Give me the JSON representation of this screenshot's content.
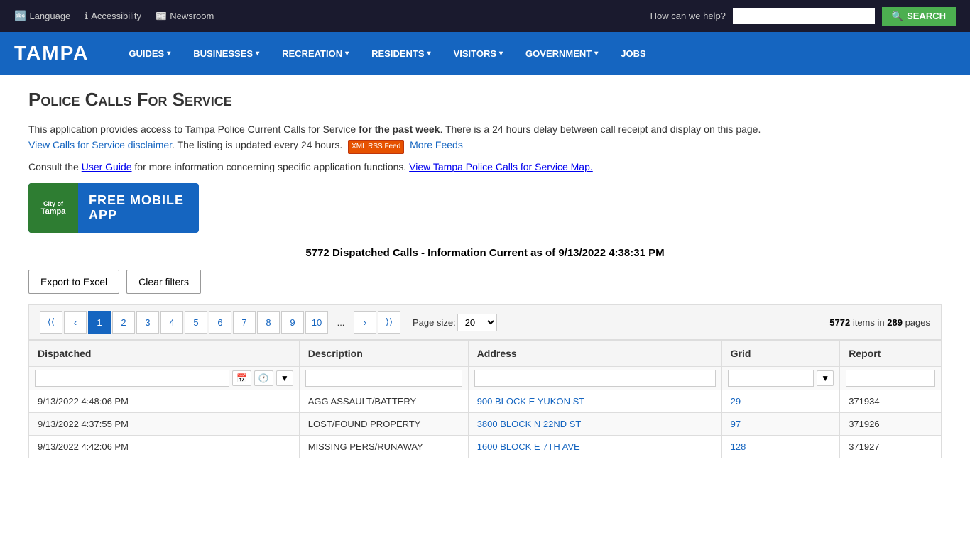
{
  "utility_bar": {
    "language_label": "Language",
    "accessibility_label": "Accessibility",
    "newsroom_label": "Newsroom",
    "search_placeholder": "",
    "search_label": "How can we help?",
    "search_btn_label": "SEARCH"
  },
  "nav": {
    "logo": "TAMPA",
    "items": [
      {
        "label": "GUIDES",
        "has_dropdown": true
      },
      {
        "label": "BUSINESSES",
        "has_dropdown": true
      },
      {
        "label": "RECREATION",
        "has_dropdown": true
      },
      {
        "label": "RESIDENTS",
        "has_dropdown": true
      },
      {
        "label": "VISITORS",
        "has_dropdown": true
      },
      {
        "label": "GOVERNMENT",
        "has_dropdown": true
      },
      {
        "label": "JOBS",
        "has_dropdown": false
      }
    ]
  },
  "page": {
    "title": "Police Calls For Service",
    "description_intro": "This application provides access to Tampa Police Current Calls for Service ",
    "description_bold": "for the past week",
    "description_cont": ". There is a 24 hours delay between call receipt and display on this page.",
    "disclaimer_link": "View Calls for Service disclaimer",
    "update_text": ". The listing is updated every 24 hours.",
    "rss_label": "XML RSS Feed",
    "more_feeds_link": "More Feeds",
    "guide_text": "Consult the ",
    "user_guide_link": "User Guide",
    "guide_cont": " for more information concerning specific application functions.",
    "map_link": "View Tampa Police Calls for Service Map.",
    "mobile_logo_line1": "City of",
    "mobile_logo_line2": "Tampa",
    "mobile_app_text": "FREE MOBILE APP",
    "dispatch_info": "5772 Dispatched Calls - Information Current as of 9/13/2022 4:38:31 PM",
    "export_btn": "Export to Excel",
    "clear_filters_btn": "Clear filters"
  },
  "pagination": {
    "pages": [
      "1",
      "2",
      "3",
      "4",
      "5",
      "6",
      "7",
      "8",
      "9",
      "10"
    ],
    "ellipsis": "...",
    "active_page": "1",
    "page_size_label": "Page size:",
    "page_size_value": "20",
    "items_count": "5772",
    "pages_count": "289",
    "items_text": "items in",
    "pages_text": "pages"
  },
  "table": {
    "columns": [
      {
        "key": "dispatched",
        "label": "Dispatched"
      },
      {
        "key": "description",
        "label": "Description"
      },
      {
        "key": "address",
        "label": "Address"
      },
      {
        "key": "grid",
        "label": "Grid"
      },
      {
        "key": "report",
        "label": "Report"
      }
    ],
    "rows": [
      {
        "dispatched": "9/13/2022 4:48:06 PM",
        "description": "AGG ASSAULT/BATTERY",
        "address": "900 BLOCK E YUKON ST",
        "grid": "29",
        "report": "371934"
      },
      {
        "dispatched": "9/13/2022 4:37:55 PM",
        "description": "LOST/FOUND PROPERTY",
        "address": "3800 BLOCK N 22ND ST",
        "grid": "97",
        "report": "371926"
      },
      {
        "dispatched": "9/13/2022 4:42:06 PM",
        "description": "MISSING PERS/RUNAWAY",
        "address": "1600 BLOCK E 7TH AVE",
        "grid": "128",
        "report": "371927"
      }
    ]
  }
}
